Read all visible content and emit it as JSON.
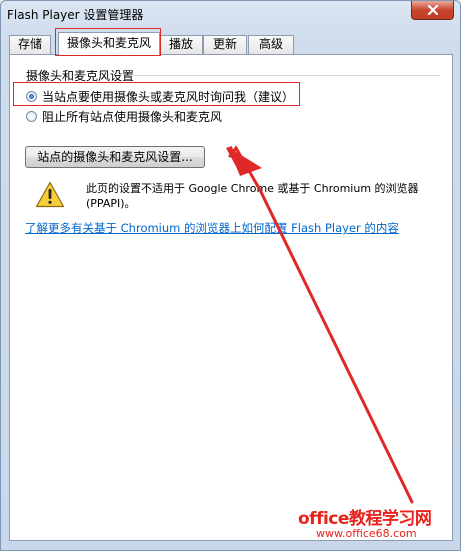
{
  "window": {
    "title": "Flash Player 设置管理器"
  },
  "tabs": [
    {
      "label": "存储",
      "active": false
    },
    {
      "label": "摄像头和麦克风",
      "active": true
    },
    {
      "label": "播放",
      "active": false
    },
    {
      "label": "更新",
      "active": false
    },
    {
      "label": "高级",
      "active": false
    }
  ],
  "camera_settings": {
    "group_label": "摄像头和麦克风设置",
    "options": [
      {
        "label": "当站点要使用摄像头或麦克风时询问我（建议）",
        "selected": true
      },
      {
        "label": "阻止所有站点使用摄像头和麦克风",
        "selected": false
      }
    ],
    "site_settings_button": "站点的摄像头和麦克风设置..."
  },
  "warning": {
    "icon": "warning-triangle-icon",
    "text": "此页的设置不适用于 Google Chrome 或基于 Chromium 的浏览器 (PPAPI)。",
    "link": "了解更多有关基于 Chromium 的浏览器上如何配置 Flash Player 的内容"
  },
  "annotation": {
    "color": "#e02828"
  },
  "watermark": {
    "line1": "office教程学习网",
    "line2": "www.office68.com",
    "color": "#e8231c"
  }
}
